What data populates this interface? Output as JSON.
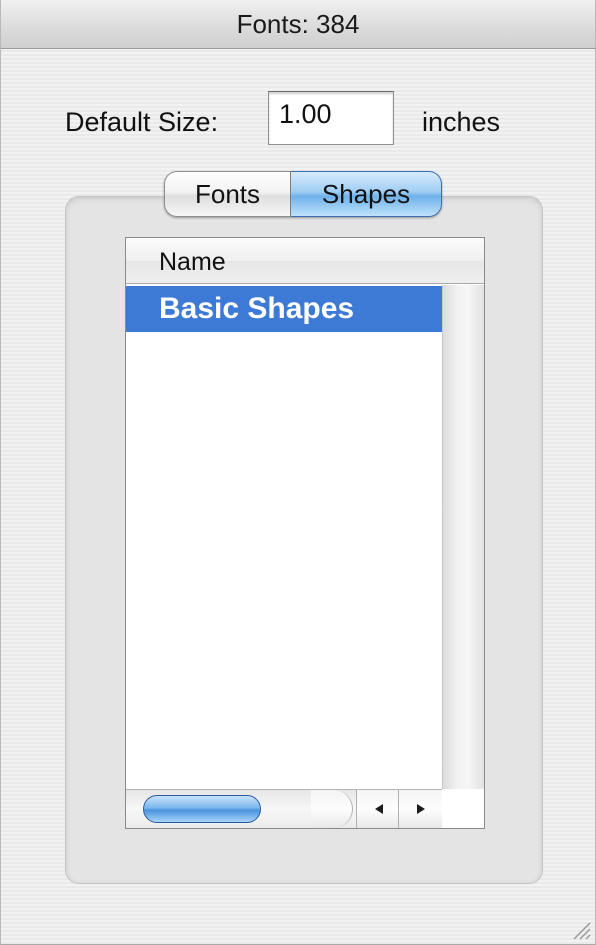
{
  "window": {
    "title": "Fonts: 384"
  },
  "size": {
    "label": "Default Size:",
    "value": "1.00",
    "units": "inches"
  },
  "tabs": [
    {
      "label": "Fonts",
      "selected": false
    },
    {
      "label": "Shapes",
      "selected": true
    }
  ],
  "list": {
    "column_header": "Name",
    "rows": [
      {
        "label": "Basic Shapes",
        "selected": true
      }
    ]
  },
  "icons": {
    "scroll_left": "left-arrow-icon",
    "scroll_right": "right-arrow-icon",
    "resize": "resize-grip-icon"
  },
  "colors": {
    "selection": "#3d7ad6",
    "aqua_accent": "#6fb1ea"
  }
}
